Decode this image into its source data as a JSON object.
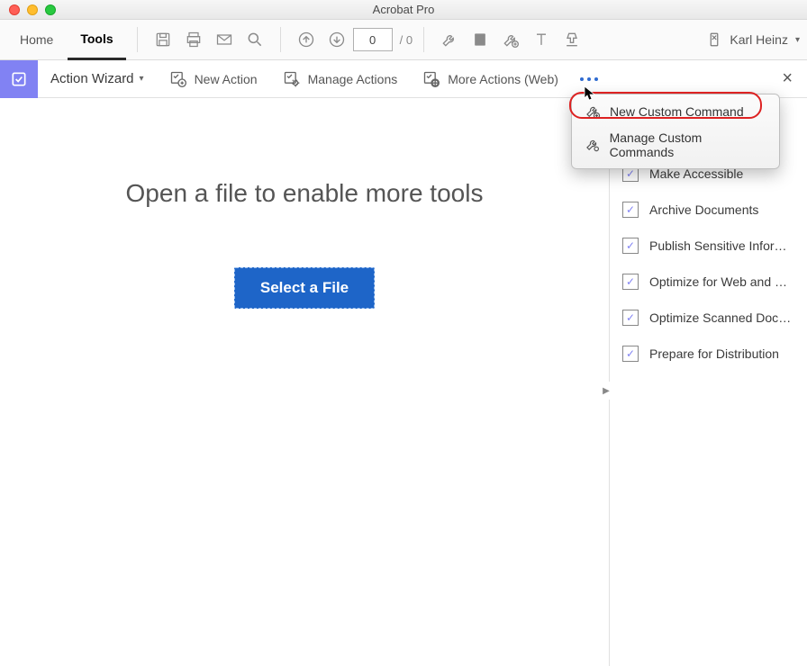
{
  "window": {
    "title": "Acrobat Pro"
  },
  "main_tabs": {
    "home": "Home",
    "tools": "Tools"
  },
  "toolbar": {
    "page_input": "0",
    "page_total": "/  0",
    "user_name": "Karl Heinz"
  },
  "action_wizard": {
    "title": "Action Wizard",
    "new_action": "New Action",
    "manage_actions": "Manage Actions",
    "more_actions_web": "More Actions (Web)"
  },
  "main": {
    "message": "Open a file to enable more tools",
    "select_button": "Select a File"
  },
  "popup": {
    "new_custom_command": "New Custom Command",
    "manage_custom_commands": "Manage Custom Commands"
  },
  "sidebar": {
    "items": [
      {
        "label": "Make Accessible"
      },
      {
        "label": "Archive Documents"
      },
      {
        "label": "Publish Sensitive Inform…"
      },
      {
        "label": "Optimize for Web and M…"
      },
      {
        "label": "Optimize Scanned Docu…"
      },
      {
        "label": "Prepare for Distribution"
      }
    ]
  }
}
